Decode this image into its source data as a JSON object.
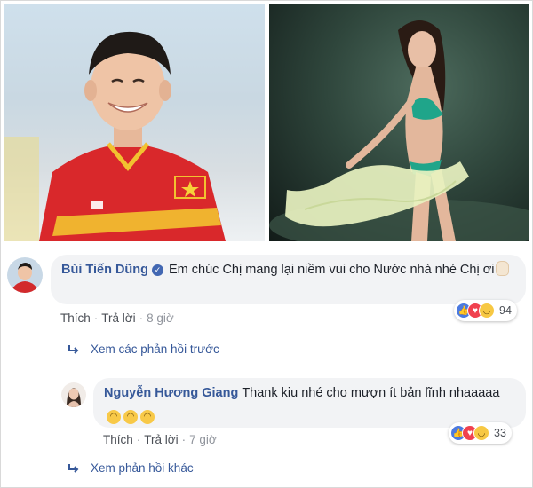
{
  "colors": {
    "author_link": "#365899",
    "bubble_bg": "#f2f3f5",
    "like_blue": "#4c7ae0",
    "love_red": "#f0414f",
    "haha_yellow": "#f7c843"
  },
  "photos": [
    {
      "id": "left",
      "subject": "footballer-in-red-jersey"
    },
    {
      "id": "right",
      "subject": "contestant-on-stage"
    }
  ],
  "comment": {
    "author": "Bùi Tiến Dũng",
    "text": "Em chúc Chị mang lại niềm vui cho Nước nhà nhé Chị ơi",
    "actions": {
      "like": "Thích",
      "reply": "Trả lời",
      "time": "8 giờ"
    },
    "reaction_count": "94"
  },
  "view_previous": "Xem các phản hồi trước",
  "reply": {
    "author": "Nguyễn Hương Giang",
    "text": "Thank kiu nhé cho mượn ít bản lĩnh nhaaaaa",
    "actions": {
      "like": "Thích",
      "reply": "Trả lời",
      "time": "7 giờ"
    },
    "reaction_count": "33"
  },
  "view_other": "Xem phản hồi khác"
}
